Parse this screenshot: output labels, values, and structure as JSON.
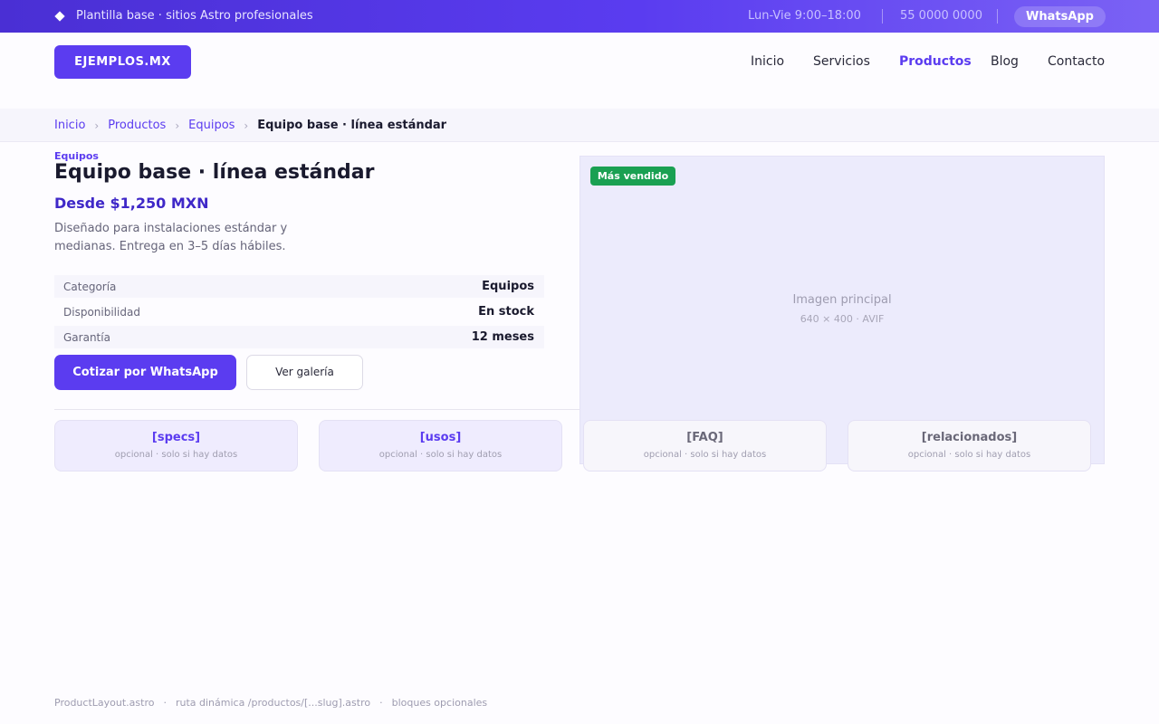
{
  "topbar": {
    "tagline": "Plantilla base · sitios Astro profesionales",
    "hours": "Lun-Vie  9:00–18:00",
    "phone": "55 0000 0000",
    "whatsapp_label": "WhatsApp"
  },
  "header": {
    "logo": "EJEMPLOS.MX",
    "nav": [
      "Inicio",
      "Servicios",
      "Productos",
      "Blog",
      "Contacto"
    ],
    "active": "Productos"
  },
  "breadcrumb": {
    "items": [
      "Inicio",
      "Productos",
      "Equipos"
    ],
    "current": "Equipo base · línea estándar",
    "separator": "›"
  },
  "product": {
    "category": "Equipos",
    "title": "Equipo base · línea estándar",
    "price": "Desde $1,250 MXN",
    "description": "Diseñado para instalaciones estándar y medianas. Entrega en 3–5 días hábiles.",
    "specs": [
      {
        "key": "Categoría",
        "value": "Equipos"
      },
      {
        "key": "Disponibilidad",
        "value": "En stock"
      },
      {
        "key": "Garantía",
        "value": "12 meses"
      }
    ],
    "primary_button": "Cotizar por WhatsApp",
    "secondary_button": "Ver galería",
    "badge": "Más vendido",
    "image_label": "Imagen principal",
    "image_meta": "640 × 400 · AVIF"
  },
  "blocks": [
    {
      "title": "[specs]",
      "subtitle": "opcional · solo si hay datos"
    },
    {
      "title": "[usos]",
      "subtitle": "opcional · solo si hay datos"
    },
    {
      "title": "[FAQ]",
      "subtitle": "opcional · solo si hay datos"
    },
    {
      "title": "[relacionados]",
      "subtitle": "opcional · solo si hay datos"
    }
  ],
  "footer": [
    "ProductLayout.astro",
    "ruta dinámica /productos/[...slug].astro",
    "bloques opcionales"
  ],
  "colors": {
    "accent": "#5b3cf0",
    "price": "#3f28c8",
    "badge": "#1aa052",
    "topbar_start": "#4a2fd4",
    "topbar_end": "#7b62f5"
  }
}
